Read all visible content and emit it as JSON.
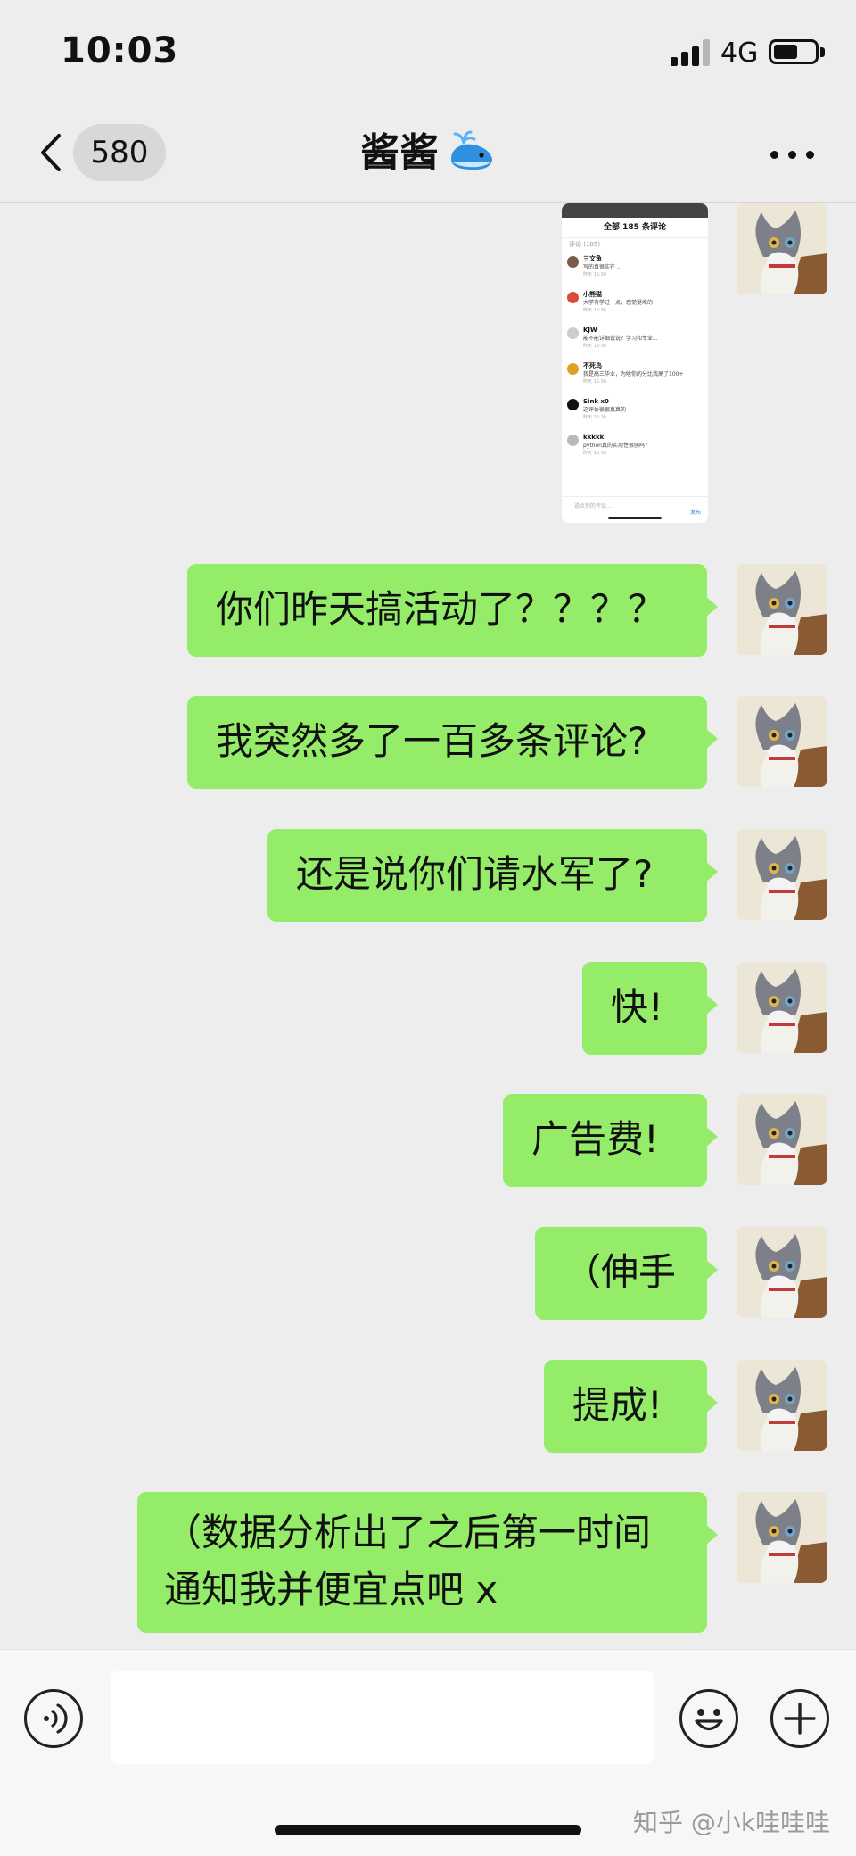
{
  "status_bar": {
    "time": "10:03",
    "network": "4G",
    "signal_bars": 4,
    "signal_active": 3
  },
  "header": {
    "back_icon": "chevron-left-icon",
    "unread_count": "580",
    "title": "酱酱",
    "title_emoji": "whale-icon",
    "more_icon": "more-dots-icon"
  },
  "shared_screenshot": {
    "title": "全部 185 条评论",
    "subtitle": "评论 (185)",
    "comments": [
      {
        "name": "三文鱼",
        "text": "写的真很实在 ..."
      },
      {
        "name": "小熊猫",
        "text": "大学有学过一点，感觉挺难的"
      },
      {
        "name": "KJW",
        "text": "能不能详细说说？学习和专业..."
      },
      {
        "name": "不死鸟",
        "text": "我是高三毕业，为啥你的分比我高了100+"
      },
      {
        "name": "Sink x0",
        "text": "这评价很很真真的"
      },
      {
        "name": "kkkkk",
        "text": "python真的实用性很强吗？"
      }
    ],
    "comment_time": "昨天 15:36",
    "input_placeholder": "说点你的评论...",
    "send_label": "发布"
  },
  "messages": [
    {
      "text": "你们昨天搞活动了？？？？"
    },
    {
      "text": "我突然多了一百多条评论?"
    },
    {
      "text": "还是说你们请水军了?"
    },
    {
      "text": "快!"
    },
    {
      "text": "广告费!"
    },
    {
      "text": "（伸手"
    },
    {
      "text": "提成!"
    },
    {
      "line1": "（数据分析出了之后第一时间",
      "line2": "通知我并便宜点吧 x"
    }
  ],
  "input_bar": {
    "voice_icon": "voice-icon",
    "emoji_icon": "emoji-icon",
    "plus_icon": "plus-icon",
    "input_value": ""
  },
  "watermark": "知乎 @小k哇哇哇",
  "colors": {
    "bubble": "#95ec69",
    "background": "#ededed"
  }
}
